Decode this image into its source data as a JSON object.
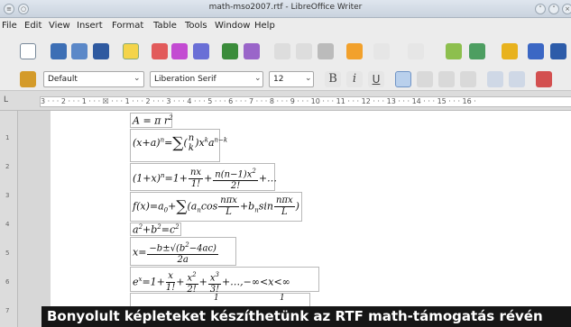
{
  "window": {
    "title": "math-mso2007.rtf - LibreOffice Writer"
  },
  "menu": [
    "File",
    "Edit",
    "View",
    "Insert",
    "Format",
    "Table",
    "Tools",
    "Window",
    "Help"
  ],
  "formatting": {
    "style": "Default",
    "font": "Liberation Serif",
    "size": "12"
  },
  "ruler": {
    "h_labels": "3 · · · 2 · · · 1 · · · ☒ · · · 1 · · · 2 · · · 3 · · · 4 · · · 5 · · · 6 · · · 7 · · · 8 · · · 9 · · · 10 · · · 11 · · · 12 · · · 13 · · · 14 · · · 15 · · · 16 ·",
    "v_labels": [
      "1",
      "2",
      "3",
      "4",
      "5",
      "6",
      "7"
    ]
  },
  "formulas": {
    "f1": "A = π r²",
    "f2": "(x+a)ⁿ = Σ (n k) xᵏ aⁿ⁻ᵏ",
    "f3": "(1+x)ⁿ = 1 + nx/1! + n(n−1)x²/2! + ...",
    "f4": "f(x) = a₀ + Σ (aₙ cos nπx/L + bₙ sin nπx/L)",
    "f5": "a² + b² = c²",
    "f6": "x = (−b ± √(b²−4ac)) / 2a",
    "f7": "eˣ = 1 + x/1! + x²/2! + x³/3! + ..., −∞ < x < ∞"
  },
  "caption": "Bonyolult képleteket készíthetünk az RTF math-támogatás révén"
}
